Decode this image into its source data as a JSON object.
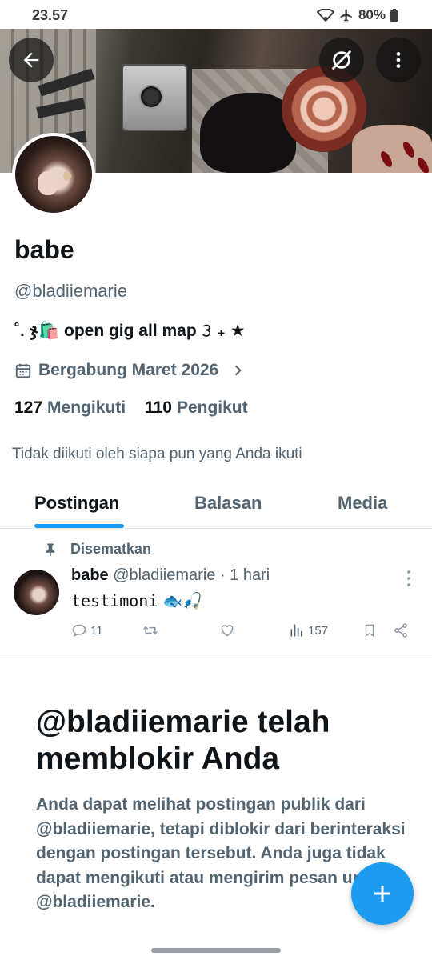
{
  "status_bar": {
    "time": "23.57",
    "battery": "80%"
  },
  "profile": {
    "name": "babe",
    "handle": "@bladiiemarie",
    "bio": "˚. ჯ🛍️ open gig all map 𝟹 ₊ ★",
    "joined": "Bergabung Maret 2026",
    "following_count": "127",
    "following_label": "Mengikuti",
    "followers_count": "110",
    "followers_label": "Pengikut",
    "not_followed_text": "Tidak diikuti oleh siapa pun yang Anda ikuti"
  },
  "tabs": [
    {
      "label": "Postingan",
      "active": true
    },
    {
      "label": "Balasan",
      "active": false
    },
    {
      "label": "Media",
      "active": false
    }
  ],
  "pinned_post": {
    "pinned_label": "Disematkan",
    "author_name": "babe",
    "author_handle": "@bladiiemarie",
    "time": "· 1 hari",
    "text": "testimoni",
    "text_emoji": "🐟🎣",
    "replies": "11",
    "views": "157"
  },
  "blocked": {
    "title": "@bladiiemarie telah memblokir Anda",
    "body": "Anda dapat melihat postingan publik dari @bladiiemarie, tetapi diblokir dari berinteraksi dengan postingan tersebut. Anda juga tidak dapat mengikuti atau mengirim pesan untuk @bladiiemarie."
  },
  "colors": {
    "accent": "#1d9bf0",
    "text_primary": "#0f1419",
    "text_secondary": "#536471"
  },
  "icons": [
    "back-arrow-icon",
    "grok-icon",
    "more-vertical-icon",
    "calendar-icon",
    "chevron-right-icon",
    "pin-icon",
    "reply-icon",
    "retweet-icon",
    "like-icon",
    "views-icon",
    "bookmark-icon",
    "share-icon",
    "plus-icon"
  ]
}
